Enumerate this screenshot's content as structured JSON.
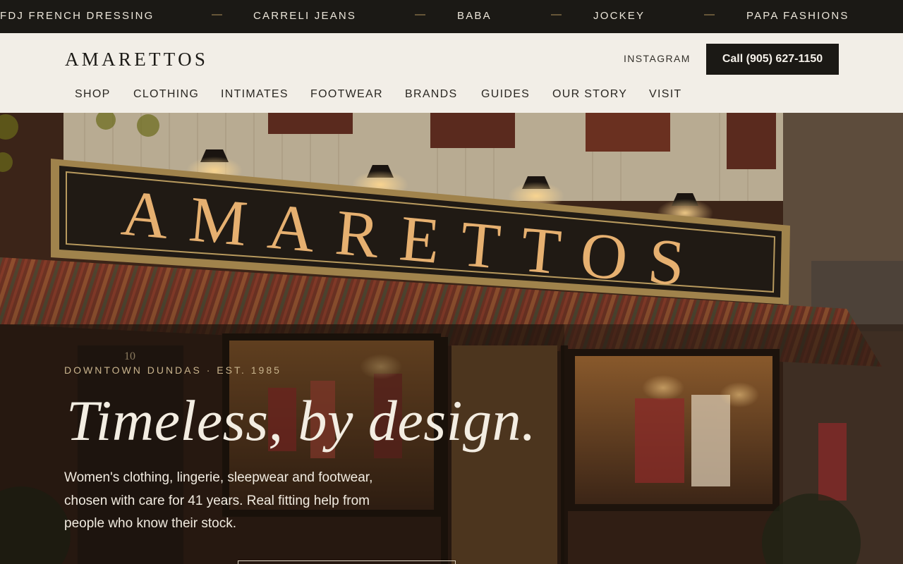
{
  "ticker": {
    "brands": [
      "FDJ FRENCH DRESSING",
      "CARRELI JEANS",
      "BABA",
      "JOCKEY",
      "PAPA FASHIONS"
    ],
    "separator": "—"
  },
  "header": {
    "logo": "AMARETTOS",
    "instagram_label": "INSTAGRAM",
    "call_label": "Call  (905) 627-1150"
  },
  "nav": {
    "items": [
      "SHOP",
      "CLOTHING",
      "INTIMATES",
      "FOOTWEAR",
      "BRANDS",
      "GUIDES",
      "OUR STORY",
      "VISIT"
    ]
  },
  "hero": {
    "sign_text": "AMARETTOS",
    "door_number": "10",
    "eyebrow": "DOWNTOWN DUNDAS · EST. 1985",
    "headline": "Timeless, by design.",
    "description": "Women's clothing, lingerie, sleepwear and footwear, chosen with care for 41 years. Real fitting help from people who know their stock."
  },
  "colors": {
    "ticker_bg": "#1b1915",
    "header_bg": "#f2eee7",
    "accent_gold": "#b0925a",
    "button_bg": "#1b1915",
    "hero_text": "#f3ede2"
  }
}
